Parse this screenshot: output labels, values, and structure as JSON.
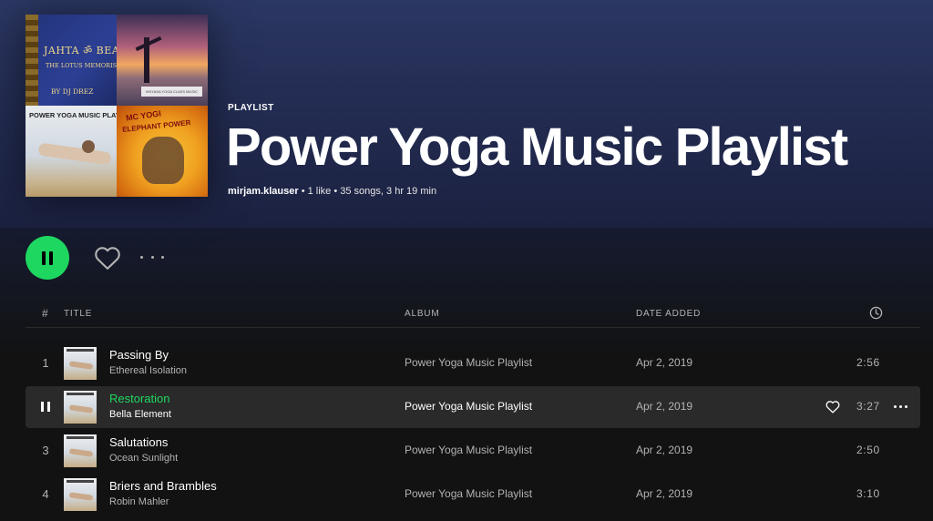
{
  "playlist": {
    "kind": "PLAYLIST",
    "title": "Power Yoga Music Playlist",
    "owner": "mirjam.klauser",
    "likes": " • 1 like • ",
    "songs": "35 songs",
    "duration": ", 3 hr 19 min"
  },
  "cover": {
    "tile1_line1": "JAHTA ॐ BEAT",
    "tile1_line2": "THE LOTUS MEMORIS",
    "tile1_line3": "BY DJ DREZ",
    "tile2_caption": "VINYASA YOGA CLASS MUSIC",
    "tile3_title": "POWER YOGA MUSIC PLAYLIST",
    "tile4_line1": "MC YOGI",
    "tile4_line2": "ELEPHANT POWER"
  },
  "controls": {
    "play_state": "playing",
    "heart_icon": "heart-outline-icon",
    "more_icon": "more-horizontal-icon"
  },
  "table_header": {
    "num": "#",
    "title": "TITLE",
    "album": "ALBUM",
    "date_added": "DATE ADDED",
    "duration_icon": "clock-icon"
  },
  "tracks": [
    {
      "num": "1",
      "title": "Passing By",
      "artist": "Ethereal Isolation",
      "album": "Power Yoga Music Playlist",
      "date": "Apr 2, 2019",
      "duration": "2:56"
    },
    {
      "num": "2",
      "title": "Restoration",
      "artist": "Bella Element",
      "album": "Power Yoga Music Playlist",
      "date": "Apr 2, 2019",
      "duration": "3:27"
    },
    {
      "num": "3",
      "title": "Salutations",
      "artist": "Ocean Sunlight",
      "album": "Power Yoga Music Playlist",
      "date": "Apr 2, 2019",
      "duration": "2:50"
    },
    {
      "num": "4",
      "title": "Briers and Brambles",
      "artist": "Robin Mahler",
      "album": "Power Yoga Music Playlist",
      "date": "Apr 2, 2019",
      "duration": "3:10"
    }
  ],
  "colors": {
    "accent": "#1ed760",
    "header_bg": "#2b3763",
    "page_bg": "#121212",
    "active_row": "#2a2a2a"
  }
}
